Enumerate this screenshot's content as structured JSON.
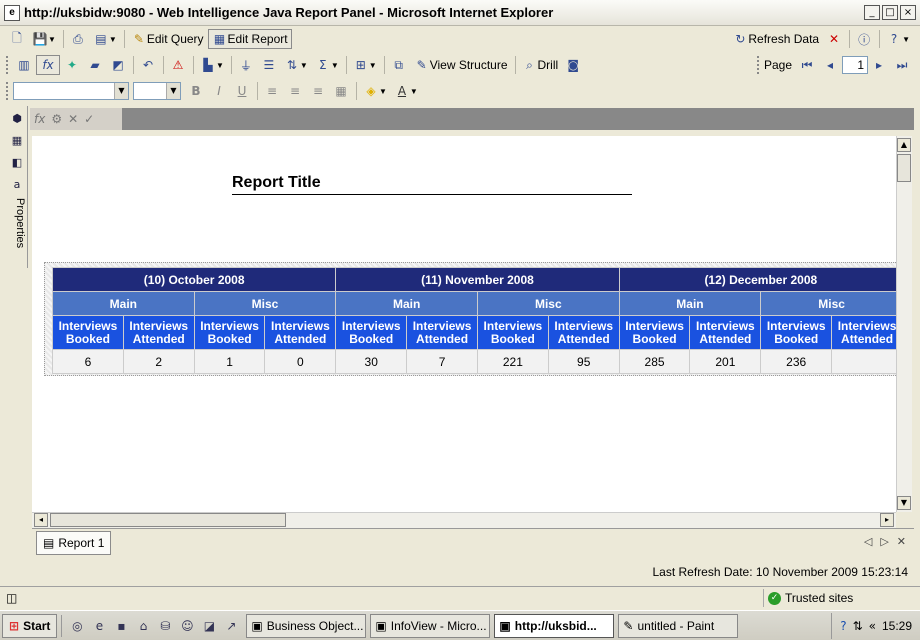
{
  "window": {
    "title": "http://uksbidw:9080 - Web Intelligence Java Report Panel - Microsoft Internet Explorer"
  },
  "toolbar1": {
    "edit_query": "Edit Query",
    "edit_report": "Edit Report",
    "refresh_data": "Refresh Data"
  },
  "toolbar2": {
    "view_structure": "View Structure",
    "drill": "Drill",
    "page_label": "Page",
    "page_value": "1"
  },
  "report": {
    "title": "Report Title",
    "months": [
      "(10) October 2008",
      "(11) November 2008",
      "(12) December 2008"
    ],
    "groups": [
      "Main",
      "Misc",
      "Main",
      "Misc",
      "Main",
      "Misc"
    ],
    "columns": [
      "Interviews Booked",
      "Interviews Attended",
      "Interviews Booked",
      "Interviews Attended",
      "Interviews Booked",
      "Interviews Attended",
      "Interviews Booked",
      "Interviews Attended",
      "Interviews Booked",
      "Interviews Attended",
      "Interviews Booked",
      "Interviews Attended"
    ],
    "values": [
      "6",
      "2",
      "1",
      "0",
      "30",
      "7",
      "221",
      "95",
      "285",
      "201",
      "236",
      ""
    ]
  },
  "left_panel": {
    "properties": "Properties"
  },
  "tabs": {
    "report1": "Report 1"
  },
  "status": {
    "last_refresh": "Last Refresh Date: 10 November 2009 15:23:14",
    "zone": "Trusted sites"
  },
  "taskbar": {
    "start": "Start",
    "items": [
      "Business Object...",
      "InfoView - Micro...",
      "http://uksbid...",
      "untitled - Paint"
    ],
    "clock": "15:29"
  }
}
